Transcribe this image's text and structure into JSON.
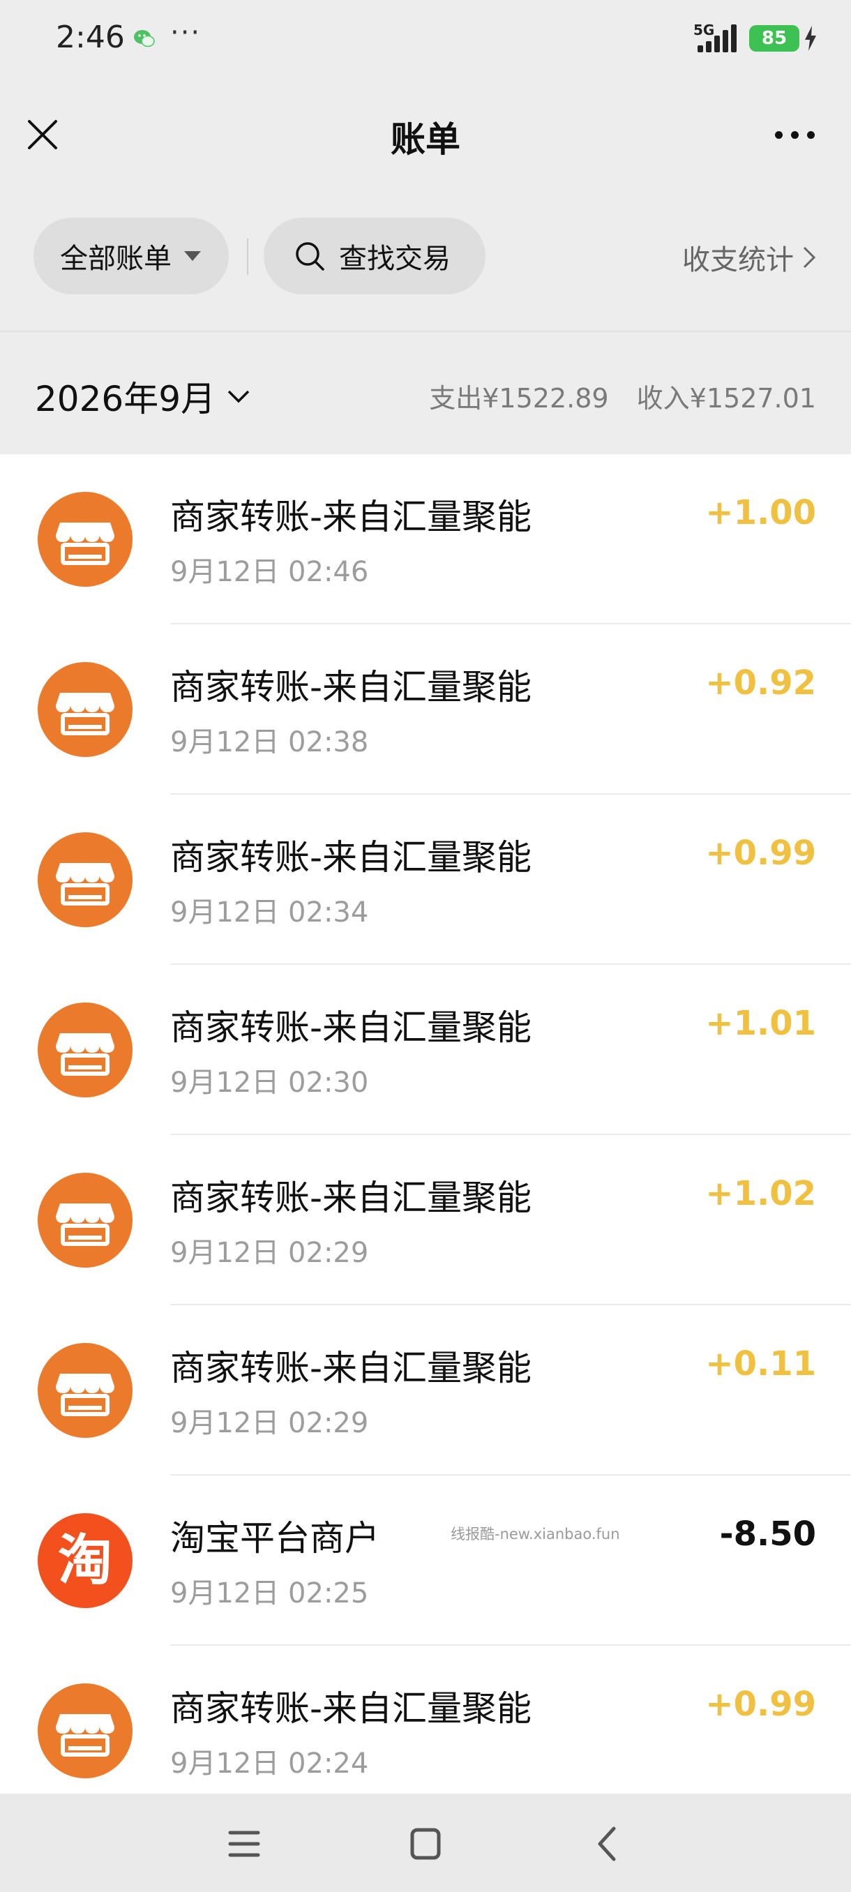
{
  "status_bar": {
    "time": "2:46",
    "more": "···",
    "network": "5G",
    "battery": "85"
  },
  "header": {
    "title": "账单"
  },
  "filters": {
    "all_bills": "全部账单",
    "search": "查找交易",
    "stats": "收支统计"
  },
  "month": {
    "label": "2026年9月",
    "expense": "支出¥1522.89",
    "income": "收入¥1527.01"
  },
  "transactions": [
    {
      "title": "商家转账-来自汇量聚能",
      "time": "9月12日 02:46",
      "amount": "+1.00",
      "icon": "merchant-store-icon"
    },
    {
      "title": "商家转账-来自汇量聚能",
      "time": "9月12日 02:38",
      "amount": "+0.92",
      "icon": "merchant-store-icon"
    },
    {
      "title": "商家转账-来自汇量聚能",
      "time": "9月12日 02:34",
      "amount": "+0.99",
      "icon": "merchant-store-icon"
    },
    {
      "title": "商家转账-来自汇量聚能",
      "time": "9月12日 02:30",
      "amount": "+1.01",
      "icon": "merchant-store-icon"
    },
    {
      "title": "商家转账-来自汇量聚能",
      "time": "9月12日 02:29",
      "amount": "+1.02",
      "icon": "merchant-store-icon"
    },
    {
      "title": "商家转账-来自汇量聚能",
      "time": "9月12日 02:29",
      "amount": "+0.11",
      "icon": "merchant-store-icon"
    },
    {
      "title": "淘宝平台商户",
      "time": "9月12日 02:25",
      "amount": "-8.50",
      "icon": "taobao-logo-icon",
      "logo_text": "淘"
    },
    {
      "title": "商家转账-来自汇量聚能",
      "time": "9月12日 02:24",
      "amount": "+0.99",
      "icon": "merchant-store-icon"
    }
  ],
  "watermark": "线报酷-new.xianbao.fun",
  "colors": {
    "income": "#f0c040",
    "expense": "#111111",
    "store_orange": "#ec7a2b",
    "taobao_orange": "#f2511e",
    "battery_green": "#3cc152"
  }
}
